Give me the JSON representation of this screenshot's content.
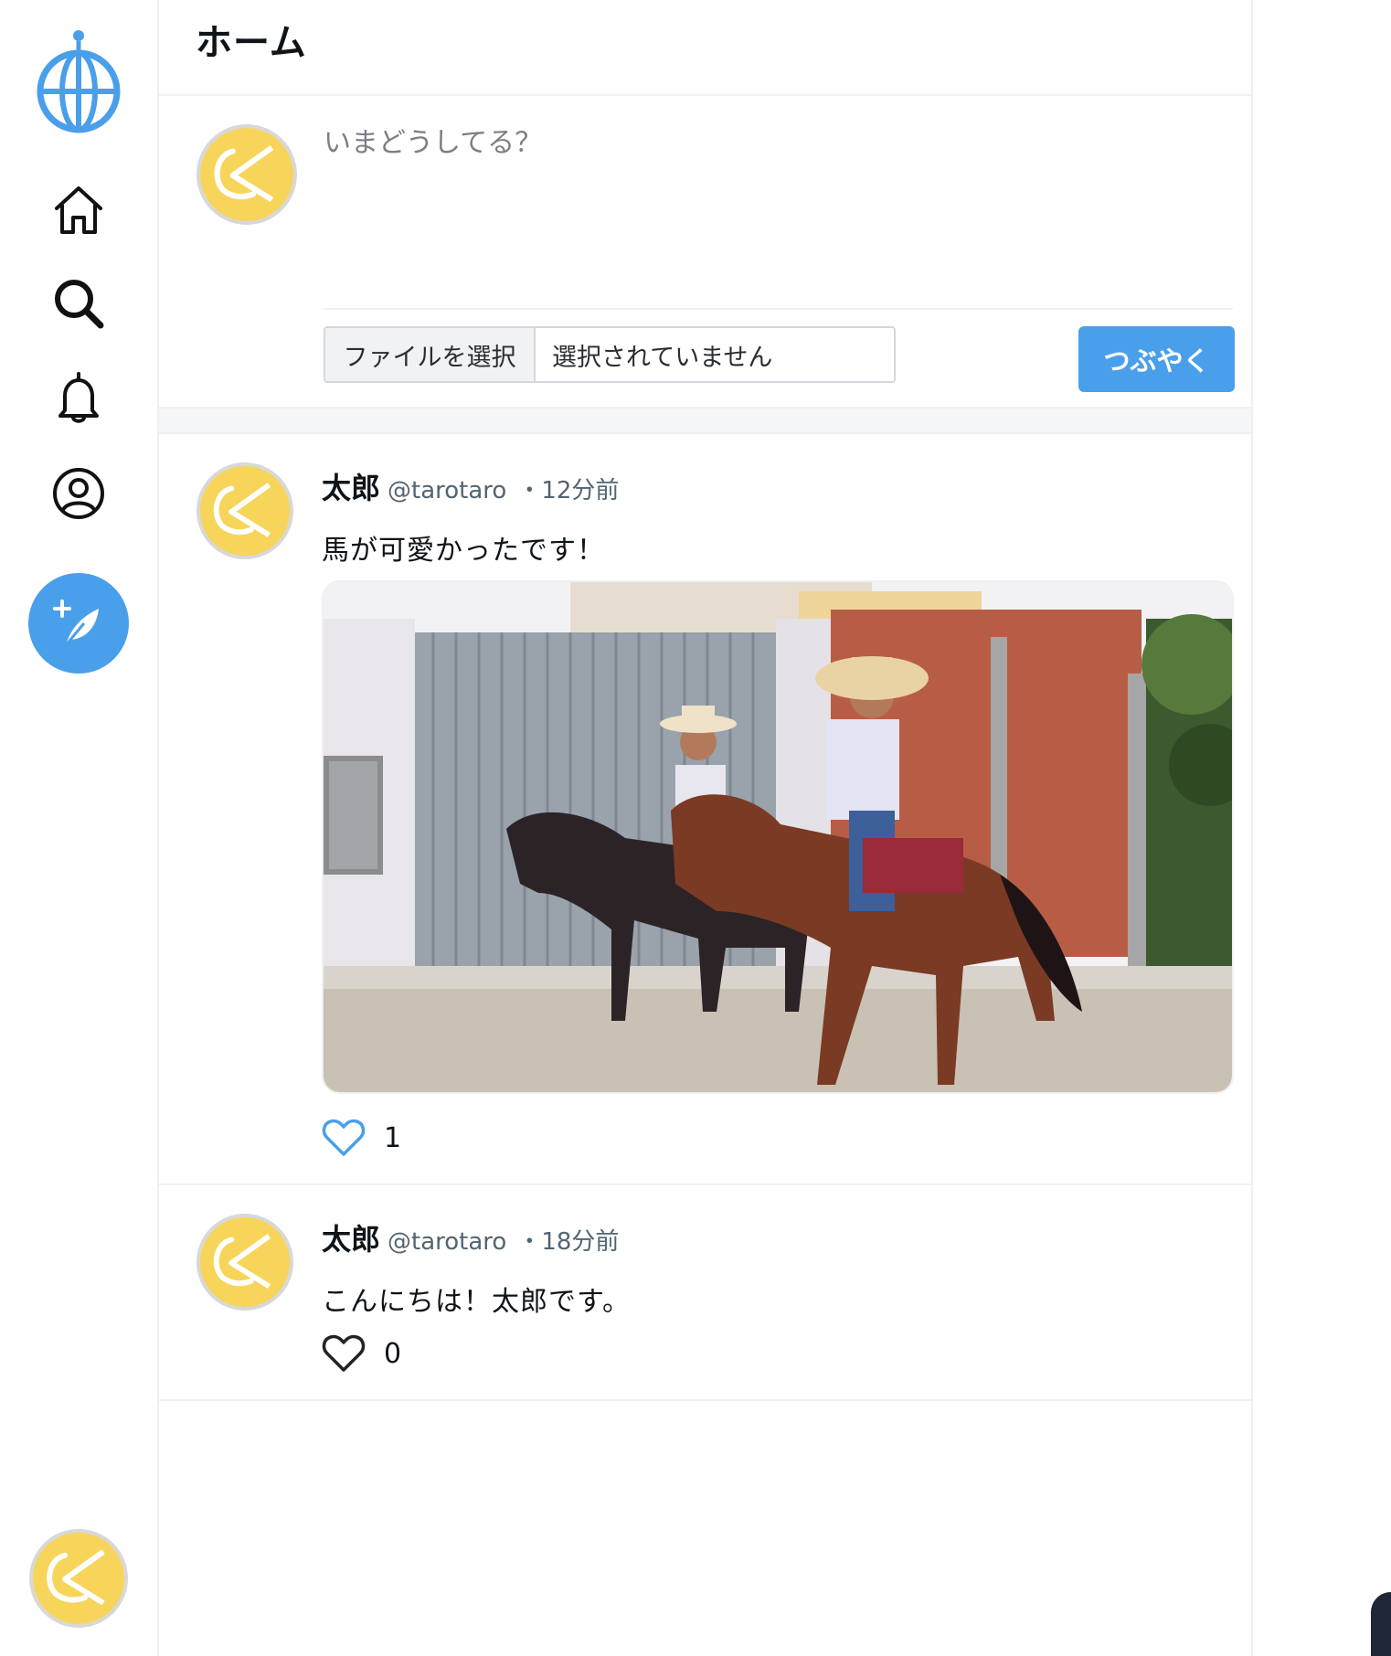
{
  "nav": {
    "logo_icon": "globe-logo-icon",
    "items": [
      {
        "name": "home",
        "icon": "home-icon"
      },
      {
        "name": "search",
        "icon": "search-icon"
      },
      {
        "name": "notifications",
        "icon": "bell-icon"
      },
      {
        "name": "profile",
        "icon": "user-icon"
      },
      {
        "name": "compose",
        "icon": "feather-plus-icon"
      }
    ],
    "account_avatar": "avatar"
  },
  "header": {
    "title": "ホーム"
  },
  "composer": {
    "placeholder": "いまどうしてる？",
    "file_button_label": "ファイルを選択",
    "file_status": "選択されていません",
    "submit_label": "つぶやく"
  },
  "posts": [
    {
      "name": "太郎",
      "handle": "@tarotaro",
      "time": "・12分前",
      "text": "馬が可愛かったです！",
      "has_image": true,
      "image_description_icon": "photo",
      "likes": "1",
      "liked": true
    },
    {
      "name": "太郎",
      "handle": "@tarotaro",
      "time": "・18分前",
      "text": "こんにちは！太郎です。",
      "has_image": false,
      "likes": "0",
      "liked": false
    }
  ],
  "colors": {
    "accent": "#4a9fea",
    "border": "#eef0f3",
    "avatar_fill": "#f7d55a"
  }
}
